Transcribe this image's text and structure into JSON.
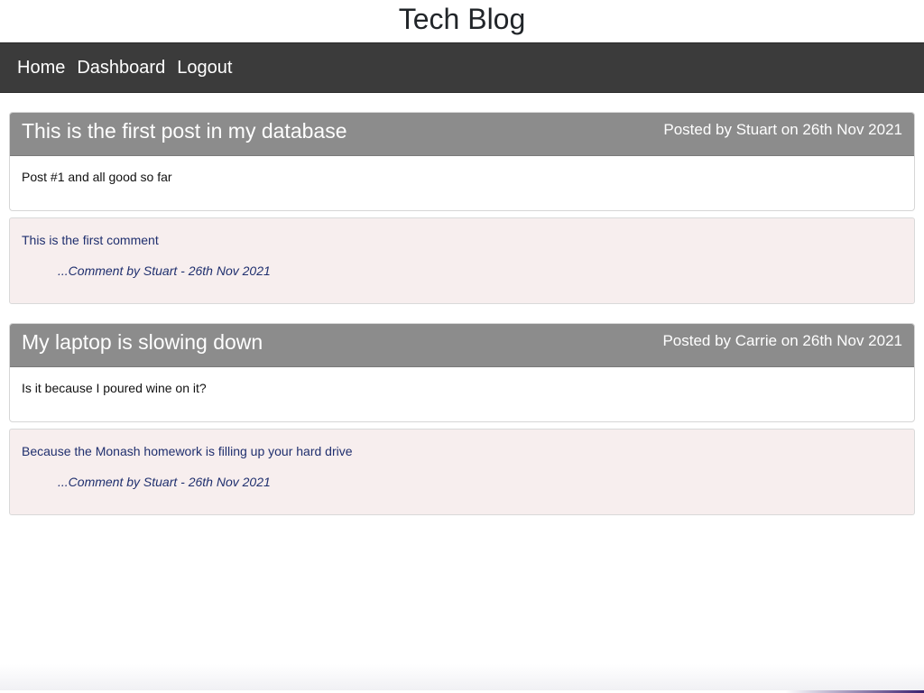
{
  "site": {
    "title": "Tech Blog"
  },
  "nav": {
    "items": [
      {
        "label": "Home"
      },
      {
        "label": "Dashboard"
      },
      {
        "label": "Logout"
      }
    ]
  },
  "posts": [
    {
      "title": "This is the first post in my database",
      "meta": "Posted by Stuart on 26th Nov 2021",
      "body": "Post #1 and all good so far",
      "comments": [
        {
          "text": "This is the first comment",
          "byline": "...Comment by Stuart - 26th Nov 2021"
        }
      ]
    },
    {
      "title": "My laptop is slowing down",
      "meta": "Posted by Carrie on 26th Nov 2021",
      "body": "Is it because I poured wine on it?",
      "comments": [
        {
          "text": "Because the Monash homework is filling up your hard drive",
          "byline": "...Comment by Stuart - 26th Nov 2021"
        }
      ]
    }
  ],
  "colors": {
    "navbar": "#3b3b3b",
    "post_header": "#8c8c8c",
    "comment_bg": "#f7eeee",
    "comment_text": "#1f2f6e"
  }
}
